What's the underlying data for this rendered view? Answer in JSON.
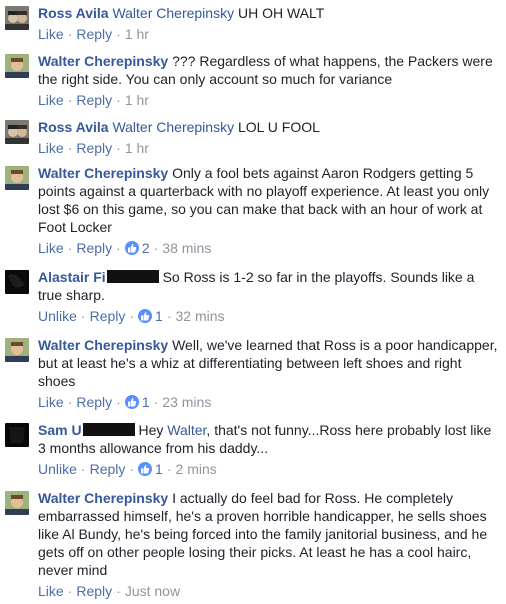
{
  "comments": [
    {
      "author": "Ross Avila",
      "mention": "Walter Cherepinsky",
      "text": "UH OH WALT",
      "like_label": "Like",
      "reply_label": "Reply",
      "time": "1 hr",
      "reactions": null
    },
    {
      "author": "Walter Cherepinsky",
      "mention": "",
      "text": "??? Regardless of what happens, the Packers were the right side. You can only account so much for variance",
      "like_label": "Like",
      "reply_label": "Reply",
      "time": "1 hr",
      "reactions": null
    },
    {
      "author": "Ross Avila",
      "mention": "Walter Cherepinsky",
      "text": "LOL U FOOL",
      "like_label": "Like",
      "reply_label": "Reply",
      "time": "1 hr",
      "reactions": null
    },
    {
      "author": "Walter Cherepinsky",
      "mention": "",
      "text": "Only a fool bets against Aaron Rodgers getting 5 points against a quarterback with no playoff experience. At least you only lost $6 on this game, so you can make that back with an hour of work at Foot Locker",
      "like_label": "Like",
      "reply_label": "Reply",
      "time": "38 mins",
      "reactions": "2"
    },
    {
      "author": "Alastair Fi",
      "mention": "",
      "text": "So Ross is 1-2 so far in the playoffs. Sounds like a true sharp.",
      "like_label": "Unlike",
      "reply_label": "Reply",
      "time": "32 mins",
      "reactions": "1"
    },
    {
      "author": "Walter Cherepinsky",
      "mention": "",
      "text": "Well, we've learned that Ross is a poor handicapper, but at least he's a whiz at differentiating between left shoes and right shoes",
      "like_label": "Like",
      "reply_label": "Reply",
      "time": "23 mins",
      "reactions": "1"
    },
    {
      "author": "Sam U",
      "mention": "",
      "text_prefix": "Hey ",
      "inline_mention": "Walter",
      "text": ", that's not funny...Ross here probably lost like 3 months allowance from his daddy...",
      "like_label": "Unlike",
      "reply_label": "Reply",
      "time": "2 mins",
      "reactions": "1"
    },
    {
      "author": "Walter Cherepinsky",
      "mention": "",
      "text": "I actually do feel bad for Ross. He completely embarrassed himself, he's a proven horrible handicapper, he sells shoes like Al Bundy, he's being forced into the family janitorial business, and he gets off on other people losing their picks. At least he has a cool hairc, never mind",
      "like_label": "Like",
      "reply_label": "Reply",
      "time": "Just now",
      "reactions": null
    }
  ],
  "separator": "·",
  "colors": {
    "link": "#365899",
    "action": "#4b6ea9",
    "meta": "#90949c",
    "like_blue": "#5890ff"
  }
}
